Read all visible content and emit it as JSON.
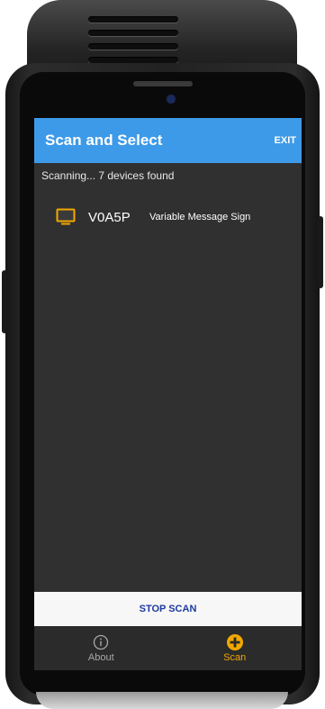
{
  "app_bar": {
    "title": "Scan and Select",
    "exit_label": "EXIT",
    "background_color": "#3d9ae8"
  },
  "scan_status": "Scanning... 7 devices found",
  "devices": [
    {
      "id": "V0A5P",
      "type": "Variable Message Sign",
      "icon": "monitor-icon",
      "icon_color": "#f2a800"
    }
  ],
  "stop_scan_label": "STOP SCAN",
  "bottom_nav": {
    "items": [
      {
        "label": "About",
        "icon": "info-icon",
        "active": false
      },
      {
        "label": "Scan",
        "icon": "add-circle-icon",
        "active": true
      }
    ],
    "active_color": "#f2a800"
  }
}
